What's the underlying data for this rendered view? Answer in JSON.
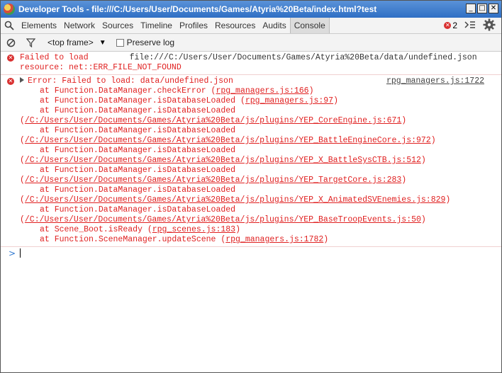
{
  "window": {
    "title": "Developer Tools - file:///C:/Users/User/Documents/Games/Atyria%20Beta/index.html?test"
  },
  "tabs": [
    "Elements",
    "Network",
    "Sources",
    "Timeline",
    "Profiles",
    "Resources",
    "Audits",
    "Console"
  ],
  "errors": {
    "count": "2"
  },
  "toolbar": {
    "frame": "<top frame>",
    "preserve_log": "Preserve log"
  },
  "console": {
    "msg1": {
      "text": "Failed to load",
      "url": "file:///C:/Users/User/Documents/Games/Atyria%20Beta/data/undefined.json",
      "resource": "resource: net::ERR_FILE_NOT_FOUND"
    },
    "msg2": {
      "header": "Error: Failed to load: data/undefined.json",
      "source": "rpg_managers.js:1722",
      "lines": [
        {
          "text": "at Function.DataManager.checkError (",
          "link": "rpg_managers.js:166",
          "tail": ")"
        },
        {
          "text": "at Function.DataManager.isDatabaseLoaded (",
          "link": "rpg_managers.js:97",
          "tail": ")"
        },
        {
          "text": "at Function.DataManager.isDatabaseLoaded"
        },
        {
          "prefix": "(",
          "link": "/C:/Users/User/Documents/Games/Atyria%20Beta/js/plugins/YEP_CoreEngine.js:671",
          "tail": ")"
        },
        {
          "text": "at Function.DataManager.isDatabaseLoaded"
        },
        {
          "prefix": "(",
          "link": "/C:/Users/User/Documents/Games/Atyria%20Beta/js/plugins/YEP_BattleEngineCore.js:972",
          "tail": ")"
        },
        {
          "text": "at Function.DataManager.isDatabaseLoaded"
        },
        {
          "prefix": "(",
          "link": "/C:/Users/User/Documents/Games/Atyria%20Beta/js/plugins/YEP_X_BattleSysCTB.js:512",
          "tail": ")"
        },
        {
          "text": "at Function.DataManager.isDatabaseLoaded"
        },
        {
          "prefix": "(",
          "link": "/C:/Users/User/Documents/Games/Atyria%20Beta/js/plugins/YEP_TargetCore.js:283",
          "tail": ")"
        },
        {
          "text": "at Function.DataManager.isDatabaseLoaded"
        },
        {
          "prefix": "(",
          "link": "/C:/Users/User/Documents/Games/Atyria%20Beta/js/plugins/YEP_X_AnimatedSVEnemies.js:829",
          "tail": ")"
        },
        {
          "text": "at Function.DataManager.isDatabaseLoaded"
        },
        {
          "prefix": "(",
          "link": "/C:/Users/User/Documents/Games/Atyria%20Beta/js/plugins/YEP_BaseTroopEvents.js:50",
          "tail": ")"
        },
        {
          "text": "at Scene_Boot.isReady (",
          "link": "rpg_scenes.js:183",
          "tail": ")"
        },
        {
          "text": "at Function.SceneManager.updateScene (",
          "link": "rpg_managers.js:1782",
          "tail": ")"
        }
      ]
    },
    "prompt": ">"
  }
}
